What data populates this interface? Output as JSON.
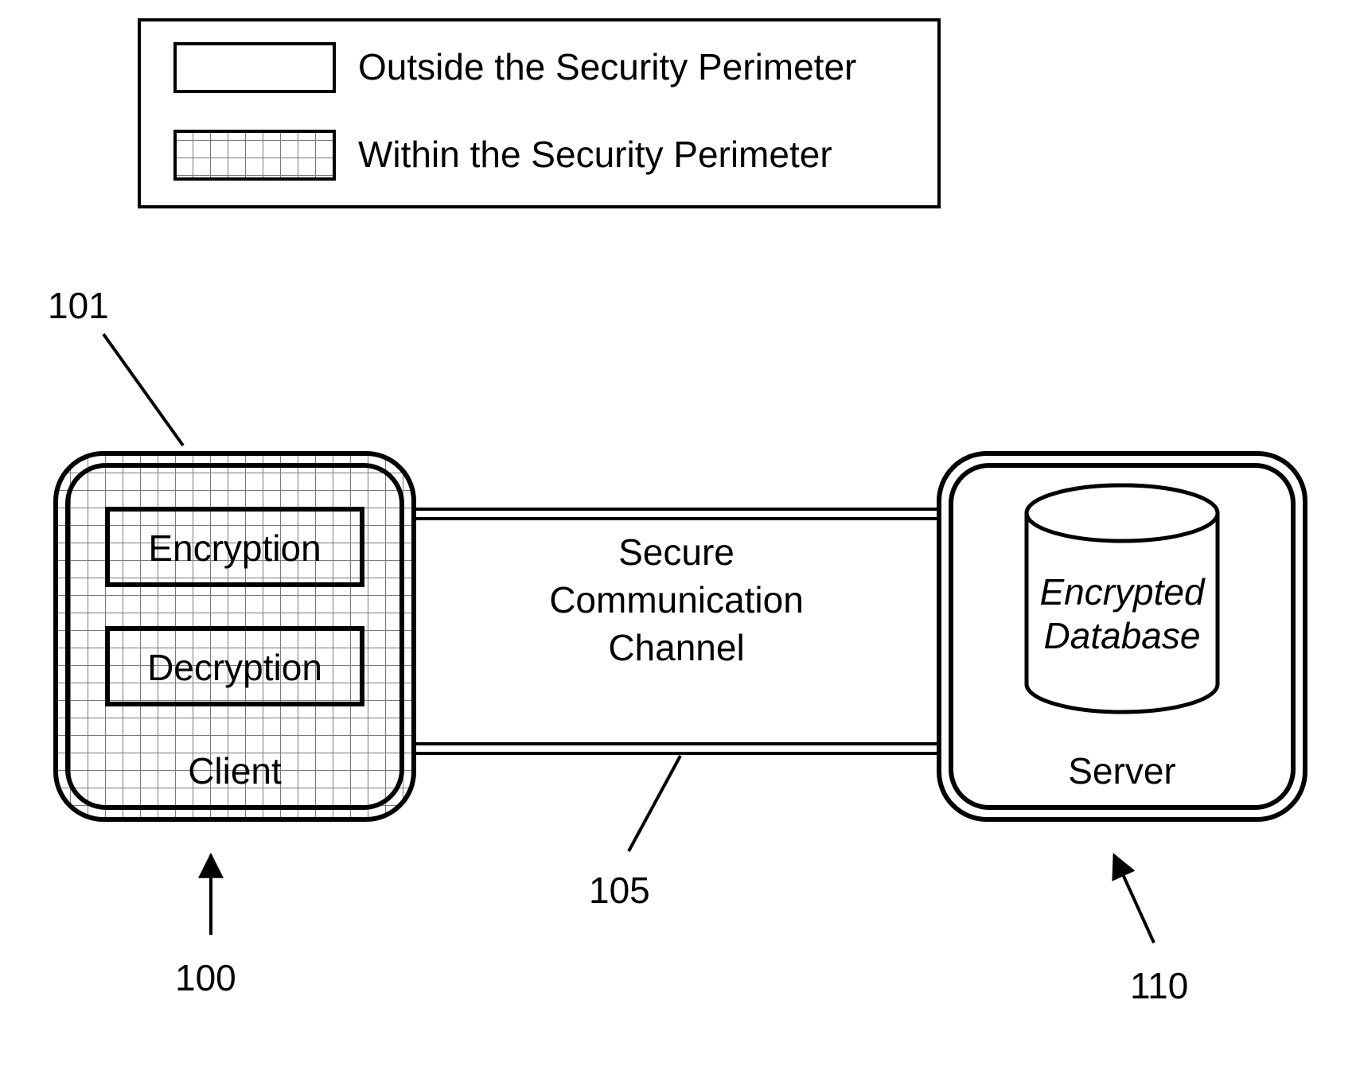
{
  "legend": {
    "outside": "Outside the Security Perimeter",
    "within": "Within the Security Perimeter"
  },
  "client": {
    "title": "Client",
    "encryption": "Encryption",
    "decryption": "Decryption"
  },
  "channel": {
    "line1": "Secure",
    "line2": "Communication",
    "line3": "Channel"
  },
  "server": {
    "title": "Server",
    "db1": "Encrypted",
    "db2": "Database"
  },
  "refs": {
    "r101": "101",
    "r100": "100",
    "r105": "105",
    "r110": "110"
  }
}
